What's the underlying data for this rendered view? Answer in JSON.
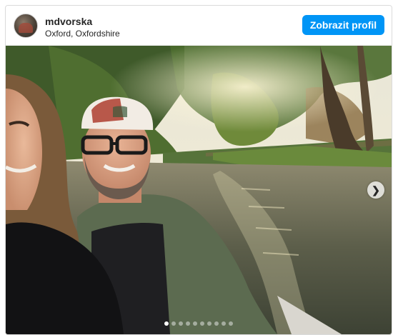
{
  "post": {
    "username": "mdvorska",
    "location": "Oxford, Oxfordshire",
    "profile_button": "Zobrazit profil",
    "avatar_icon": "avatar-photo",
    "next_icon": "chevron-right-icon",
    "carousel": {
      "total": 10,
      "active_index": 0
    }
  },
  "colors": {
    "accent": "#0095f6",
    "border": "#dbdbdb",
    "text": "#262626"
  }
}
